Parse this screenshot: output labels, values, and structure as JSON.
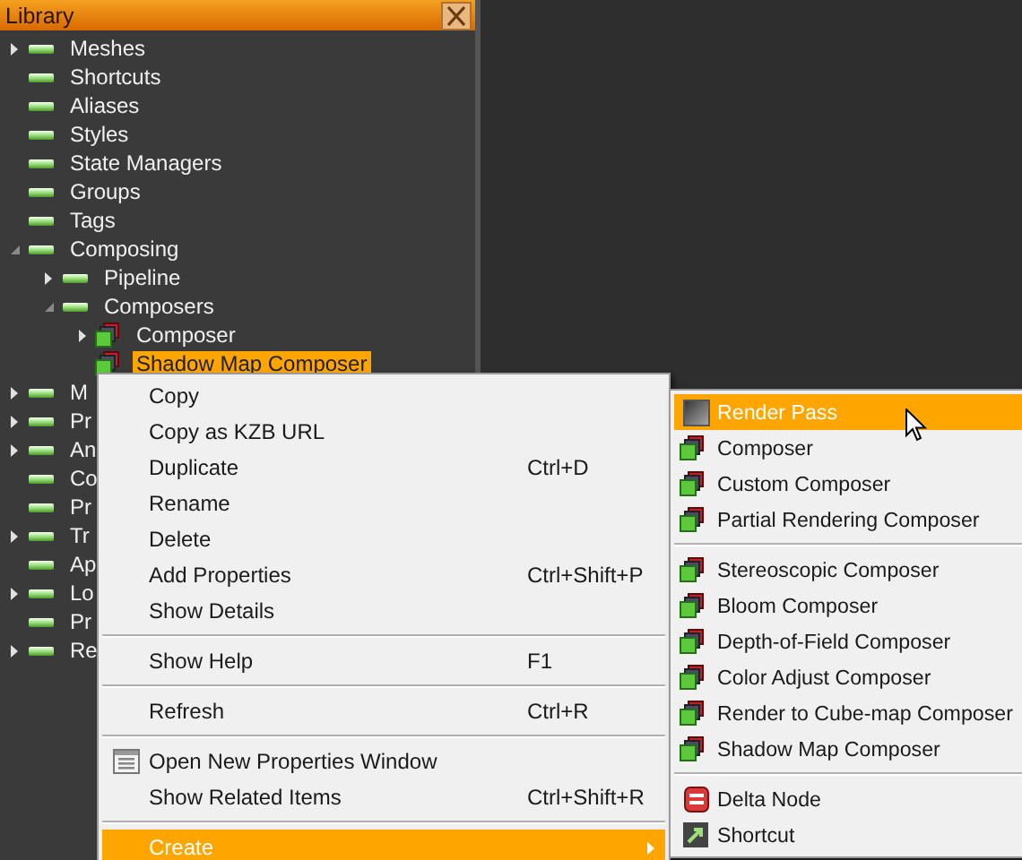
{
  "panel": {
    "title": "Library"
  },
  "tree": [
    {
      "label": "Meshes",
      "expandable": true,
      "expanded": false,
      "kind": "folder",
      "selected": false
    },
    {
      "label": "Shortcuts",
      "expandable": false,
      "kind": "folder",
      "selected": false
    },
    {
      "label": "Aliases",
      "expandable": false,
      "kind": "folder",
      "selected": false
    },
    {
      "label": "Styles",
      "expandable": false,
      "kind": "folder",
      "selected": false
    },
    {
      "label": "State Managers",
      "expandable": false,
      "kind": "folder",
      "selected": false
    },
    {
      "label": "Groups",
      "expandable": false,
      "kind": "folder",
      "selected": false
    },
    {
      "label": "Tags",
      "expandable": false,
      "kind": "folder",
      "selected": false
    },
    {
      "label": "Composing",
      "expandable": true,
      "expanded": true,
      "kind": "folder",
      "selected": false,
      "children": [
        {
          "label": "Pipeline",
          "expandable": true,
          "expanded": false,
          "kind": "folder",
          "selected": false
        },
        {
          "label": "Composers",
          "expandable": true,
          "expanded": true,
          "kind": "folder",
          "selected": false,
          "children": [
            {
              "label": "Composer",
              "expandable": true,
              "expanded": false,
              "kind": "composer",
              "selected": false
            },
            {
              "label": "Shadow Map Composer",
              "expandable": false,
              "kind": "composer",
              "selected": true
            }
          ]
        }
      ]
    },
    {
      "label": "M",
      "expandable": true,
      "expanded": false,
      "kind": "folder",
      "selected": false
    },
    {
      "label": "Pr",
      "expandable": true,
      "expanded": false,
      "kind": "folder",
      "selected": false
    },
    {
      "label": "An",
      "expandable": true,
      "expanded": false,
      "kind": "folder",
      "selected": false
    },
    {
      "label": "Co",
      "expandable": false,
      "kind": "folder",
      "selected": false
    },
    {
      "label": "Pr",
      "expandable": false,
      "kind": "folder",
      "selected": false
    },
    {
      "label": "Tr",
      "expandable": true,
      "expanded": false,
      "kind": "folder",
      "selected": false
    },
    {
      "label": "Ap",
      "expandable": false,
      "kind": "folder",
      "selected": false
    },
    {
      "label": "Lo",
      "expandable": true,
      "expanded": false,
      "kind": "folder",
      "selected": false
    },
    {
      "label": "Pr",
      "expandable": false,
      "kind": "folder",
      "selected": false
    },
    {
      "label": "Re",
      "expandable": true,
      "expanded": false,
      "kind": "folder",
      "selected": false
    }
  ],
  "context_menu": [
    {
      "kind": "item",
      "label": "Copy",
      "selected": false
    },
    {
      "kind": "item",
      "label": "Copy as KZB URL",
      "selected": false
    },
    {
      "kind": "item",
      "label": "Duplicate",
      "shortcut": "Ctrl+D",
      "selected": false
    },
    {
      "kind": "item",
      "label": "Rename",
      "selected": false
    },
    {
      "kind": "item",
      "label": "Delete",
      "selected": false
    },
    {
      "kind": "item",
      "label": "Add Properties",
      "shortcut": "Ctrl+Shift+P",
      "selected": false
    },
    {
      "kind": "item",
      "label": "Show Details",
      "selected": false
    },
    {
      "kind": "separator"
    },
    {
      "kind": "item",
      "label": "Show Help",
      "shortcut": "F1",
      "selected": false
    },
    {
      "kind": "separator"
    },
    {
      "kind": "item",
      "label": "Refresh",
      "shortcut": "Ctrl+R",
      "selected": false
    },
    {
      "kind": "separator"
    },
    {
      "kind": "window",
      "label": "Open New Properties Window",
      "selected": false
    },
    {
      "kind": "item",
      "label": "Show Related Items",
      "shortcut": "Ctrl+Shift+R",
      "selected": false
    },
    {
      "kind": "separator"
    },
    {
      "kind": "submenu",
      "label": "Create",
      "selected": true
    }
  ],
  "create_submenu": [
    {
      "kind": "render-pass",
      "label": "Render Pass",
      "selected": true
    },
    {
      "kind": "composer",
      "label": "Composer",
      "selected": false
    },
    {
      "kind": "composer",
      "label": "Custom Composer",
      "selected": false
    },
    {
      "kind": "composer",
      "label": "Partial Rendering Composer",
      "selected": false
    },
    {
      "kind": "separator"
    },
    {
      "kind": "composer",
      "label": "Stereoscopic Composer",
      "selected": false
    },
    {
      "kind": "composer",
      "label": "Bloom Composer",
      "selected": false
    },
    {
      "kind": "composer",
      "label": "Depth-of-Field Composer",
      "selected": false
    },
    {
      "kind": "composer",
      "label": "Color Adjust Composer",
      "selected": false
    },
    {
      "kind": "composer",
      "label": "Render to Cube-map Composer",
      "selected": false
    },
    {
      "kind": "composer",
      "label": "Shadow Map Composer",
      "selected": false
    },
    {
      "kind": "separator"
    },
    {
      "kind": "delta-node",
      "label": "Delta Node",
      "selected": false
    },
    {
      "kind": "shortcut",
      "label": "Shortcut",
      "selected": false
    }
  ]
}
